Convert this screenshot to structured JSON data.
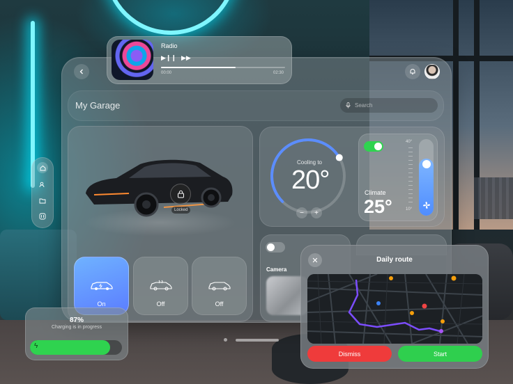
{
  "radio": {
    "title": "Radio",
    "time_start": "00:00",
    "time_end": "02:30",
    "progress": 0.6,
    "play_icon": "play-pause-icon",
    "next_icon": "fast-forward-icon"
  },
  "header": {
    "title": "My Garage",
    "search_placeholder": "Search"
  },
  "car": {
    "lock_label": "Locked"
  },
  "modes": [
    {
      "label": "On",
      "state": "active"
    },
    {
      "label": "Off",
      "state": "inactive"
    },
    {
      "label": "Off",
      "state": "inactive"
    }
  ],
  "thermostat": {
    "caption": "Cooling to",
    "temperature": "20°",
    "dial_fraction": 0.72
  },
  "climate": {
    "label": "Climate",
    "temperature": "25°",
    "scale_high": "40°",
    "scale_low": "10°",
    "toggle_on": true,
    "slider_level": 0.75
  },
  "camera": {
    "label": "Camera",
    "toggle_on": false
  },
  "route": {
    "title": "Daily route",
    "dismiss_label": "Dismiss",
    "start_label": "Start"
  },
  "charging": {
    "percent": "87%",
    "status": "Charging is in progress",
    "level": 0.87
  },
  "colors": {
    "accent_blue": "#5b8dff",
    "green": "#2fd34f",
    "red": "#ef3b3b"
  }
}
